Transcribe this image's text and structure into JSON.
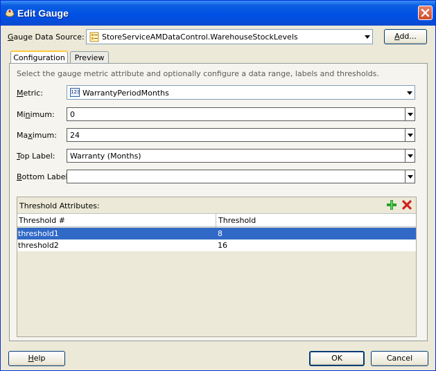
{
  "window": {
    "title": "Edit Gauge"
  },
  "data_source": {
    "label_pre": "",
    "label_mnemonic": "G",
    "label_post": "auge Data Source:",
    "value": "StoreServiceAMDataControl.WarehouseStockLevels",
    "add_pre": "",
    "add_mnemonic": "A",
    "add_post": "dd..."
  },
  "tabs": [
    {
      "label": "Configuration",
      "active": true
    },
    {
      "label": "Preview",
      "active": false
    }
  ],
  "hint": "Select the gauge metric attribute and optionally configure a data range, labels and thresholds.",
  "fields": {
    "metric": {
      "pre": "",
      "mn": "M",
      "post": "etric:",
      "value": "WarrantyPeriodMonths",
      "type_badge": "123"
    },
    "minimum": {
      "pre": "Mi",
      "mn": "n",
      "post": "imum:",
      "value": "0"
    },
    "maximum": {
      "pre": "Ma",
      "mn": "x",
      "post": "imum:",
      "value": "24"
    },
    "top_label": {
      "pre": "",
      "mn": "T",
      "post": "op Label:",
      "value": "Warranty (Months)"
    },
    "bottom_label": {
      "pre": "",
      "mn": "B",
      "post": "ottom Label:",
      "value": ""
    }
  },
  "thresholds": {
    "title": "Threshold Attributes:",
    "columns": [
      "Threshold #",
      "Threshold"
    ],
    "rows": [
      {
        "name": "threshold1",
        "value": "8",
        "selected": true
      },
      {
        "name": "threshold2",
        "value": "16",
        "selected": false
      }
    ]
  },
  "footer": {
    "help_mn": "H",
    "help_post": "elp",
    "ok": "OK",
    "cancel": "Cancel"
  },
  "colors": {
    "titlebar": "#0050e6",
    "selection": "#3169c6",
    "add_icon": "#2aa12a",
    "delete_icon": "#d0201c"
  }
}
